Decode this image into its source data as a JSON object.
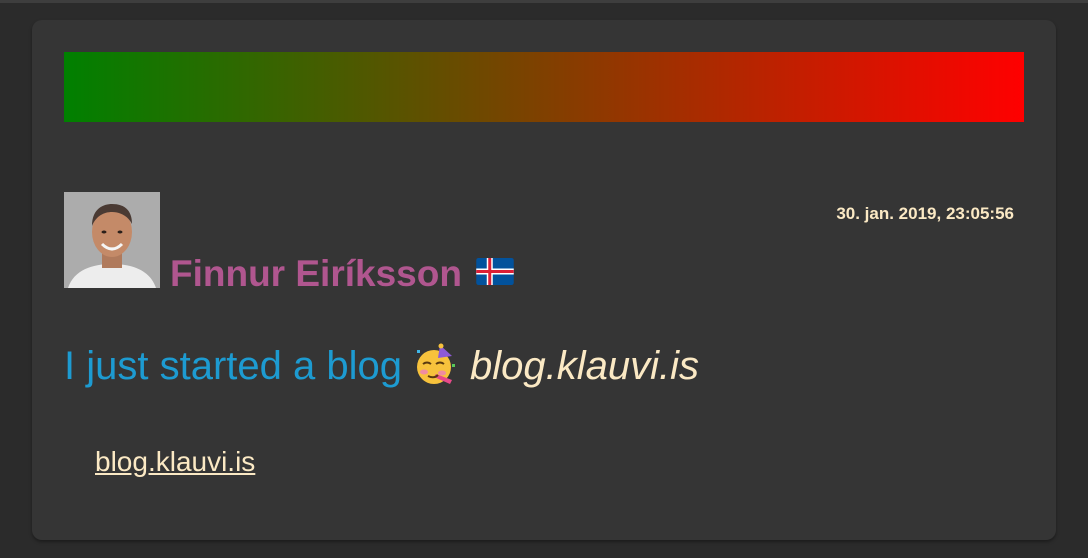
{
  "post": {
    "author_name": "Finnur Eiríksson",
    "timestamp": "30. jan. 2019, 23:05:56",
    "message_text": "I just started a blog",
    "message_emoji": "partying-face-icon",
    "message_link": "blog.klauvi.is",
    "link_text": "blog.klauvi.is",
    "flag": "iceland-flag-icon"
  },
  "colors": {
    "background": "#2b2b2b",
    "card": "#353535",
    "gradient_start": "#008000",
    "gradient_end": "#ff0000",
    "author": "#b0568f",
    "message": "#1d9bd1",
    "accent": "#fbe9c4"
  }
}
